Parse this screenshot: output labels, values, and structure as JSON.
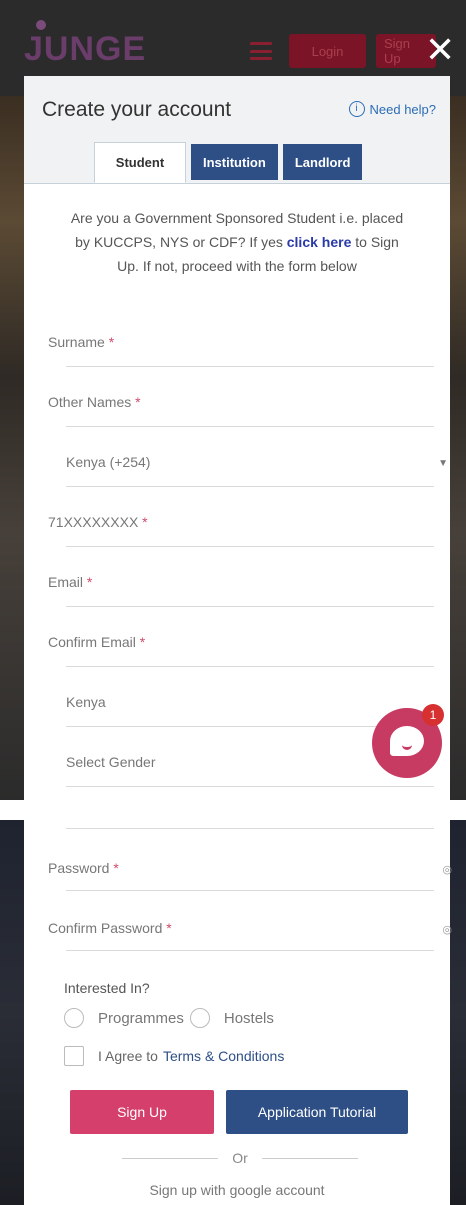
{
  "header": {
    "logo": "JUNGE",
    "login_label": "Login",
    "signup_label": "Sign Up",
    "close_symbol": "✕"
  },
  "modal": {
    "title": "Create your account",
    "help_label": "Need help?",
    "tabs": [
      {
        "label": "Student",
        "active": true
      },
      {
        "label": "Institution",
        "active": false
      },
      {
        "label": "Landlord",
        "active": false
      }
    ],
    "notice": {
      "part1": "Are you a Government Sponsored Student i.e. placed by KUCCPS, NYS or CDF? If yes ",
      "link": "click here",
      "part2": " to Sign Up. If not, proceed with the form below"
    },
    "fields": {
      "surname": "Surname",
      "other_names": "Other Names",
      "country_code": "Kenya (+254)",
      "phone": "71XXXXXXXX",
      "email": "Email",
      "confirm_email": "Confirm Email",
      "country": "Kenya",
      "gender": "Select Gender",
      "password": "Password",
      "confirm_password": "Confirm Password"
    },
    "required_mark": "*",
    "interested_in": {
      "label": "Interested In?",
      "options": [
        "Programmes",
        "Hostels"
      ]
    },
    "agree": {
      "text": "I Agree to",
      "link": "Terms & Conditions"
    },
    "buttons": {
      "signup": "Sign Up",
      "tutorial": "Application Tutorial"
    },
    "or_label": "Or",
    "google_label": "Sign up with google account"
  },
  "chat": {
    "badge_count": "1"
  },
  "colors": {
    "primary_blue": "#2d4f86",
    "accent_pink": "#d43f6b",
    "link_blue": "#2c6db5"
  }
}
